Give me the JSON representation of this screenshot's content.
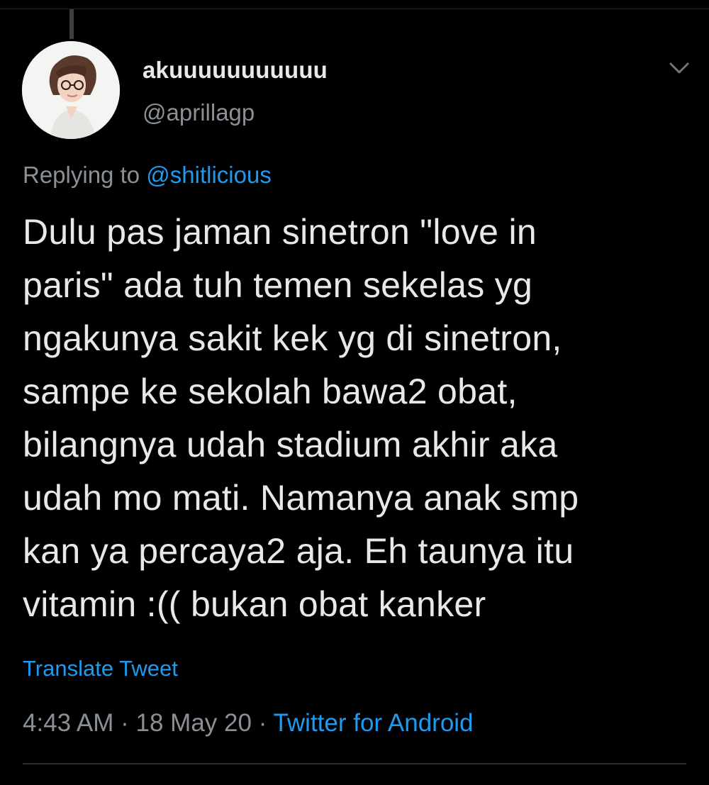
{
  "tweet": {
    "display_name": "akuuuuuuuuuuu",
    "handle": "@aprillagp",
    "reply_prefix": "Replying to",
    "reply_to": "@shitlicious",
    "lines": [
      "Dulu pas jaman sinetron \"love in",
      "paris\" ada tuh temen sekelas yg",
      "ngakunya sakit kek yg di sinetron,",
      "sampe ke sekolah bawa2 obat,",
      "bilangnya udah stadium akhir aka",
      "udah mo mati. Namanya anak smp",
      "kan ya percaya2 aja. Eh taunya itu",
      "vitamin :(( bukan obat kanker"
    ],
    "translate_label": "Translate Tweet",
    "time": "4:43 AM",
    "separator": " · ",
    "date": "18 May 20",
    "source": "Twitter for Android"
  },
  "colors": {
    "background": "#000000",
    "text": "#e8e8e8",
    "secondary": "#8a9095",
    "accent": "#1d9bf0"
  },
  "icons": {
    "avatar": "user-avatar",
    "menu": "chevron-down-icon"
  }
}
